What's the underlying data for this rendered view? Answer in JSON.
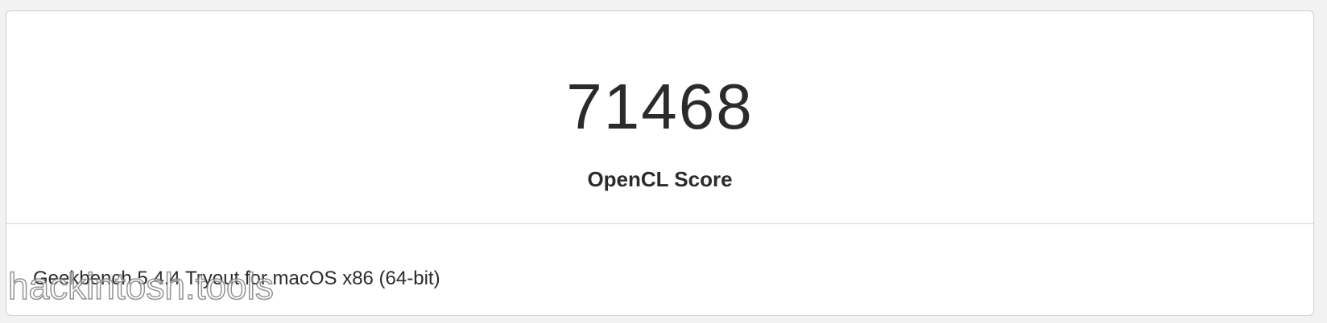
{
  "result": {
    "score": "71468",
    "score_label": "OpenCL Score"
  },
  "info": {
    "version": "Geekbench 5.4.4 Tryout for macOS x86 (64-bit)"
  },
  "watermark": {
    "text": "hackintosh.tools"
  }
}
